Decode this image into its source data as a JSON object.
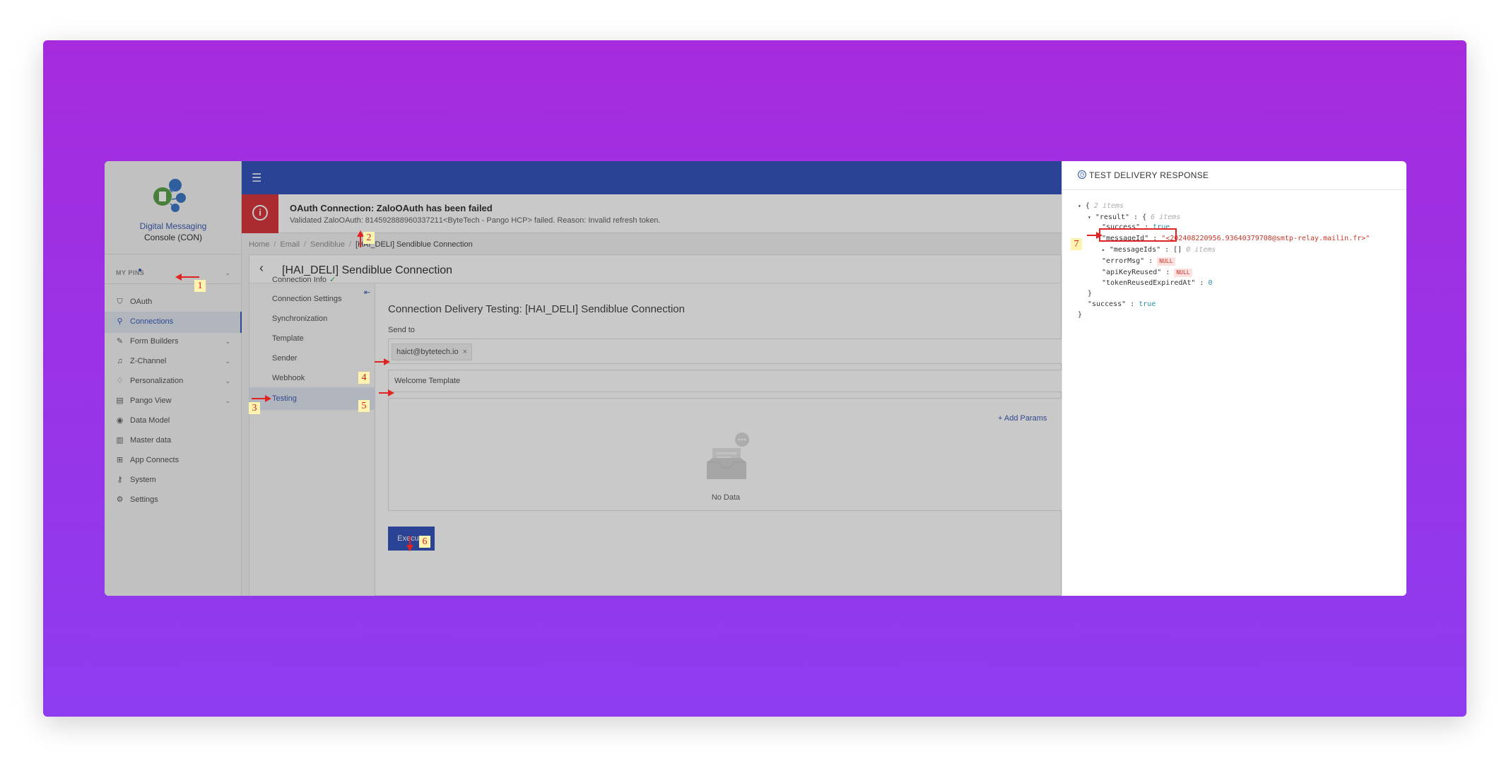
{
  "brand": {
    "title": "Digital Messaging",
    "subtitle": "Console (CON)"
  },
  "sidebar": {
    "pins_label": "MY PINS",
    "items": [
      {
        "label": "OAuth",
        "icon": "shield-icon",
        "glyph": "⛉",
        "chevron": false,
        "active": false
      },
      {
        "label": "Connections",
        "icon": "link-icon",
        "glyph": "⚲",
        "chevron": false,
        "active": true
      },
      {
        "label": "Form Builders",
        "icon": "edit-icon",
        "glyph": "✎",
        "chevron": true,
        "active": false
      },
      {
        "label": "Z-Channel",
        "icon": "bell-icon",
        "glyph": "♫",
        "chevron": true,
        "active": false
      },
      {
        "label": "Personalization",
        "icon": "shirt-icon",
        "glyph": "♢",
        "chevron": true,
        "active": false
      },
      {
        "label": "Pango View",
        "icon": "layout-icon",
        "glyph": "▤",
        "chevron": true,
        "active": false
      },
      {
        "label": "Data Model",
        "icon": "model-icon",
        "glyph": "◉",
        "chevron": false,
        "active": false
      },
      {
        "label": "Master data",
        "icon": "document-icon",
        "glyph": "▥",
        "chevron": false,
        "active": false
      },
      {
        "label": "App Connects",
        "icon": "apps-icon",
        "glyph": "⊞",
        "chevron": false,
        "active": false
      },
      {
        "label": "System",
        "icon": "key-icon",
        "glyph": "⚷",
        "chevron": false,
        "active": false
      },
      {
        "label": "Settings",
        "icon": "gear-icon",
        "glyph": "⚙",
        "chevron": false,
        "active": false
      }
    ]
  },
  "alert": {
    "title": "OAuth Connection: ZaloOAuth has been failed",
    "message": "Validated ZaloOAuth: 8145928889603372‍11<ByteTech - Pango HCP> failed. Reason: Invalid refresh token."
  },
  "breadcrumb": [
    "Home",
    "Email",
    "Sendiblue",
    "[HAI_DELI] Sendiblue Connection"
  ],
  "page_title": "[HAI_DELI] Sendiblue Connection",
  "subnav": [
    {
      "label": "Connection Info",
      "ok": "✓",
      "active": false
    },
    {
      "label": "Connection Settings",
      "ok": "",
      "active": false
    },
    {
      "label": "Synchronization",
      "ok": "",
      "active": false
    },
    {
      "label": "Template",
      "ok": "",
      "active": false
    },
    {
      "label": "Sender",
      "ok": "",
      "active": false
    },
    {
      "label": "Webhook",
      "ok": "",
      "active": false
    },
    {
      "label": "Testing",
      "ok": "",
      "active": true
    }
  ],
  "testing": {
    "title": "Connection Delivery Testing: [HAI_DELI] Sendiblue Connection",
    "send_to_label": "Send to",
    "recipient": "haict@bytetech.io",
    "chip_remove": "×",
    "template": "Welcome Template",
    "add_params": "+ Add Params",
    "no_data": "No Data",
    "execute": "Execute"
  },
  "drawer": {
    "title": "TEST DELIVERY RESPONSE",
    "json_lines": [
      {
        "indent": 0,
        "tri": "▾",
        "key": "",
        "sep": "{",
        "val": "",
        "type": "meta",
        "meta": "2 items"
      },
      {
        "indent": 1,
        "tri": "▾",
        "key": "\"result\"",
        "sep": " : {",
        "val": "",
        "type": "meta",
        "meta": "6 items"
      },
      {
        "indent": 2,
        "tri": "",
        "key": "\"success\"",
        "sep": " : ",
        "val": "true",
        "type": "bool",
        "meta": ""
      },
      {
        "indent": 2,
        "tri": "",
        "key": "\"messageId\"",
        "sep": " : ",
        "val": "\"<202408220956.93640379708@smtp-relay.mailin.fr>\"",
        "type": "str",
        "meta": ""
      },
      {
        "indent": 2,
        "tri": "▸",
        "key": "\"messageIds\"",
        "sep": " : []",
        "val": "",
        "type": "meta",
        "meta": "0 items"
      },
      {
        "indent": 2,
        "tri": "",
        "key": "\"errorMsg\"",
        "sep": " : ",
        "val": "NULL",
        "type": "null",
        "meta": ""
      },
      {
        "indent": 2,
        "tri": "",
        "key": "\"apiKeyReused\"",
        "sep": " : ",
        "val": "NULL",
        "type": "null",
        "meta": ""
      },
      {
        "indent": 2,
        "tri": "",
        "key": "\"tokenReusedExpiredAt\"",
        "sep": " : ",
        "val": "0",
        "type": "num",
        "meta": ""
      },
      {
        "indent": 1,
        "tri": "",
        "key": "}",
        "sep": "",
        "val": "",
        "type": "",
        "meta": ""
      },
      {
        "indent": 1,
        "tri": "",
        "key": "\"success\"",
        "sep": " : ",
        "val": "true",
        "type": "bool",
        "meta": ""
      },
      {
        "indent": 0,
        "tri": "",
        "key": "}",
        "sep": "",
        "val": "",
        "type": "",
        "meta": ""
      }
    ]
  },
  "annotations": [
    "1",
    "2",
    "3",
    "4",
    "5",
    "6",
    "7"
  ],
  "colors": {
    "accent": "#2546b8",
    "alert": "#d6262b",
    "annotation": "#e02424",
    "background_gradient": "#a52bdd"
  }
}
